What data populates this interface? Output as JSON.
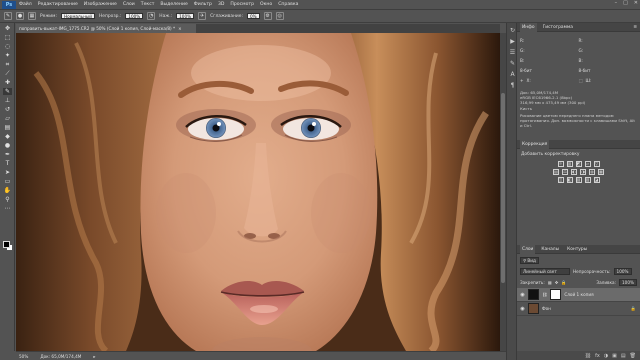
{
  "menu": {
    "logo": "Ps",
    "items": [
      "Файл",
      "Редактирование",
      "Изображение",
      "Слои",
      "Текст",
      "Выделение",
      "Фильтр",
      "3D",
      "Просмотр",
      "Окно",
      "Справка"
    ],
    "window_controls": [
      "–",
      "□",
      "✕"
    ]
  },
  "options": {
    "mode_label": "Режим:",
    "mode_value": "Нормальный",
    "opacity_label": "Непрозр.:",
    "opacity_value": "100%",
    "flow_label": "Наж.:",
    "flow_value": "100%",
    "smoothing_label": "Сглаживание:",
    "smoothing_value": "0%"
  },
  "document": {
    "tab_title": "поправить-выкат-IMG_1775.CR2 @ 50% (Слой 1 копия, Слой-маска/8) *",
    "close_glyph": "×"
  },
  "status": {
    "zoom": "50%",
    "doc_info": "Док: 65,0M/174,4M"
  },
  "panels": {
    "info": {
      "tabs": [
        "Инфо",
        "Гистограмма"
      ],
      "rgb_label": "R:",
      "g_label": "G:",
      "b_label": "B:",
      "bit_left": "8-бит",
      "bit_right": "8-бит",
      "x_label": "X:",
      "y_label": "Y:",
      "w_label": "Ш:",
      "h_label": "В:",
      "doc_line": "Док: 65,0M/174,4M",
      "profile_line": "eRGB IEC61966-2.1 (8bpc)",
      "size_line": "316,99 мм x 475,49 мм (300 ppi)",
      "tool_name": "Кисть",
      "hint": "Рисование цветом переднего плана методом протягивания. Доп. возможности с клавишами Shift, Alt и Ctrl."
    },
    "adjustments": {
      "tab": "Коррекция",
      "title": "Добавить корректировку",
      "row1": [
        "☼",
        "▥",
        "◩",
        "▱",
        "▽"
      ],
      "row2": [
        "▤",
        "⚖",
        "◐",
        "◑",
        "◍",
        "▦"
      ],
      "row3": [
        "◫",
        "◧",
        "▧",
        "▨",
        "◪"
      ]
    },
    "layers": {
      "tabs": [
        "Слои",
        "Каналы",
        "Контуры"
      ],
      "filter_label": "Вид",
      "blend_mode": "Линейный свет",
      "opacity_label": "Непрозрачность:",
      "opacity_value": "100%",
      "lock_label": "Закрепить:",
      "fill_label": "Заливка:",
      "fill_value": "100%",
      "rows": [
        {
          "name": "Слой 1 копия",
          "selected": true
        },
        {
          "name": "Фон",
          "selected": false
        }
      ],
      "footer_icons": [
        "⛓",
        "fx",
        "◑",
        "▣",
        "▤",
        "🗑"
      ]
    }
  }
}
